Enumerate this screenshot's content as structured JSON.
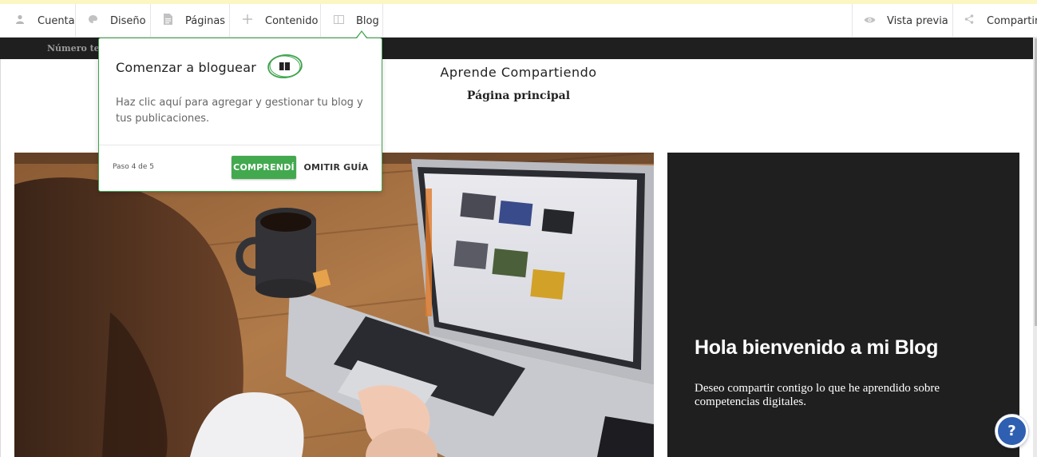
{
  "toolbar": {
    "left_items": [
      {
        "label": "Cuenta",
        "icon": "user-icon"
      },
      {
        "label": "Diseño",
        "icon": "palette-icon"
      },
      {
        "label": "Páginas",
        "icon": "page-icon"
      },
      {
        "label": "Contenido",
        "icon": "plus-icon"
      },
      {
        "label": "Blog",
        "icon": "blog-icon"
      }
    ],
    "right_items": [
      {
        "label": "Vista previa",
        "icon": "eye-icon"
      },
      {
        "label": "Compartir",
        "icon": "share-icon"
      }
    ]
  },
  "site": {
    "phone_label": "Número tele",
    "title": "Aprende Compartiendo",
    "subtitle": "Página principal"
  },
  "hero": {
    "heading": "Hola bienvenido a mi Blog",
    "text": "Deseo compartir contigo lo que he aprendido sobre competencias digitales."
  },
  "guide": {
    "title": "Comenzar a bloguear",
    "description": "Haz clic aquí para agregar y gestionar tu blog y tus publicaciones.",
    "step": "Paso 4 de 5",
    "ok_label": "COMPRENDÍ",
    "skip_label": "OMITIR GUÍA"
  },
  "help": {
    "label": "?"
  },
  "colors": {
    "accent_green": "#43a94f",
    "dark_bar": "#1f1f1f",
    "help_blue": "#2f5fb1"
  }
}
